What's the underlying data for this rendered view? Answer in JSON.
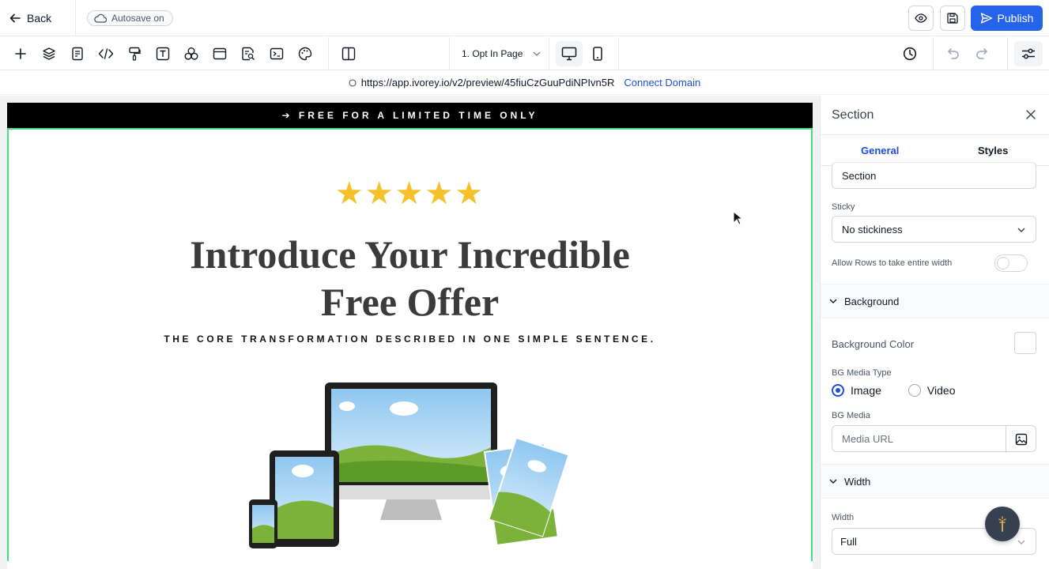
{
  "topbar": {
    "back_label": "Back",
    "autosave_label": "Autosave on",
    "publish_label": "Publish",
    "icons": [
      "arrow-left-icon",
      "cloud-icon",
      "eye-icon",
      "save-icon",
      "send-icon"
    ]
  },
  "toolbar": {
    "tools": [
      "plus-icon",
      "layers-icon",
      "page-icon",
      "code-icon",
      "paint-roller-icon",
      "text-icon",
      "shapes-icon",
      "layout-icon",
      "search-doc-icon",
      "terminal-icon",
      "palette-icon",
      "split-view-icon"
    ],
    "page_selector": "1. Opt In Page",
    "devices": [
      "desktop-icon",
      "mobile-icon"
    ],
    "right_icons": [
      "history-icon",
      "undo-icon",
      "redo-icon",
      "settings-sliders-icon"
    ]
  },
  "url": {
    "address": "https://app.ivorey.io/v2/preview/45fiuCzGuuPdiNPIvn5R",
    "connect_label": "Connect Domain"
  },
  "canvas": {
    "banner_text": "➔ FREE FOR A LIMITED TIME ONLY",
    "stars": "★★★★★",
    "headline": "Introduce Your Incredible Free Offer",
    "subline": "THE CORE TRANSFORMATION DESCRIBED IN ONE SIMPLE SENTENCE."
  },
  "panel": {
    "title": "Section",
    "tabs": [
      {
        "label": "General",
        "active": true
      },
      {
        "label": "Styles",
        "active": false
      }
    ],
    "name_value": "Section",
    "sticky_label": "Sticky",
    "sticky_value": "No stickiness",
    "allow_rows_label": "Allow Rows to take entire width",
    "allow_rows_on": false,
    "background_group": "Background",
    "background_color_label": "Background Color",
    "background_color_value": "#ffffff",
    "bg_media_type_label": "BG Media Type",
    "bg_media_options": [
      {
        "label": "Image",
        "checked": true
      },
      {
        "label": "Video",
        "checked": false
      }
    ],
    "bg_media_label": "BG Media",
    "media_url_placeholder": "Media URL",
    "width_group": "Width",
    "width_label": "Width",
    "width_value": "Full"
  },
  "colors": {
    "accent": "#2563eb",
    "section_outline": "#4ade80",
    "star": "#f6c02a"
  }
}
